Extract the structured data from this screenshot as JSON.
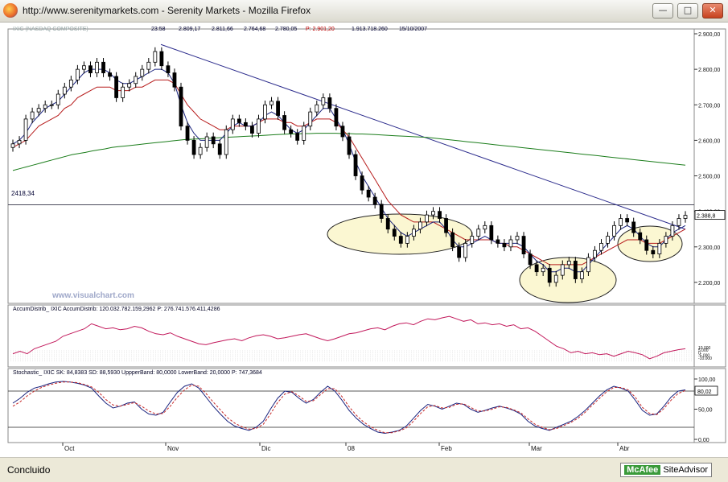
{
  "window": {
    "title": "http://www.serenitymarkets.com - Serenity Markets - Mozilla Firefox"
  },
  "status": {
    "text": "Concluido",
    "mcafee_brand": "McAfee",
    "mcafee_label": "SiteAdvisor"
  },
  "colors": {
    "price_axis_bg": "#ffffff",
    "ma_short": "#1a237e",
    "ma_mid": "#b71c1c",
    "ma_long": "#1b7d1b",
    "trendline": "#2b2b8c",
    "ellipse_fill": "#fbf7d2",
    "accum": "#c2185b",
    "stoch_k": "#1a237e",
    "stoch_d": "#c62828"
  },
  "chart_data": {
    "type": "candlestick",
    "header": {
      "time": "23:58",
      "open": "2.809,17",
      "high": "2.811,66",
      "low": "2.764,68",
      "close": "2.780,05",
      "p": "P: 2.901,20",
      "volume": "1.913.718.260",
      "date": "15/10/2007"
    },
    "watermark": "www.visualchart.com",
    "reference_line": {
      "value": 2418.34,
      "label": "2418,34"
    },
    "last_price_label": "2.388,8",
    "y_axis": {
      "min": 2150,
      "max": 2900,
      "ticks": [
        "2.900,00",
        "2.800,00",
        "2.700,00",
        "2.600,00",
        "2.500,00",
        "2.400,00",
        "2.300,00",
        "2.200,00"
      ]
    },
    "x_axis_labels": [
      "Oct",
      "Nov",
      "Dic",
      "08",
      "Feb",
      "Mar",
      "Abr"
    ],
    "closes": [
      2590,
      2600,
      2660,
      2680,
      2690,
      2700,
      2700,
      2730,
      2750,
      2770,
      2800,
      2810,
      2790,
      2820,
      2790,
      2780,
      2720,
      2750,
      2760,
      2780,
      2800,
      2820,
      2850,
      2810,
      2790,
      2750,
      2640,
      2600,
      2560,
      2580,
      2610,
      2590,
      2560,
      2630,
      2660,
      2650,
      2640,
      2620,
      2660,
      2700,
      2710,
      2670,
      2630,
      2620,
      2600,
      2640,
      2680,
      2700,
      2720,
      2690,
      2640,
      2610,
      2560,
      2500,
      2460,
      2440,
      2420,
      2380,
      2350,
      2330,
      2310,
      2330,
      2350,
      2370,
      2390,
      2400,
      2380,
      2340,
      2300,
      2270,
      2310,
      2330,
      2350,
      2360,
      2320,
      2310,
      2300,
      2320,
      2330,
      2280,
      2250,
      2230,
      2240,
      2200,
      2220,
      2250,
      2260,
      2210,
      2230,
      2270,
      2290,
      2310,
      2330,
      2360,
      2380,
      2370,
      2340,
      2320,
      2290,
      2280,
      2310,
      2330,
      2360,
      2380,
      2388.8
    ],
    "ma_short": [
      2590,
      2600,
      2620,
      2650,
      2670,
      2690,
      2700,
      2710,
      2730,
      2750,
      2770,
      2790,
      2800,
      2800,
      2800,
      2790,
      2770,
      2760,
      2760,
      2770,
      2780,
      2790,
      2800,
      2800,
      2790,
      2760,
      2700,
      2650,
      2620,
      2600,
      2600,
      2600,
      2600,
      2620,
      2640,
      2650,
      2640,
      2640,
      2650,
      2670,
      2680,
      2670,
      2650,
      2630,
      2620,
      2630,
      2650,
      2670,
      2690,
      2690,
      2660,
      2630,
      2590,
      2540,
      2500,
      2470,
      2440,
      2410,
      2380,
      2360,
      2340,
      2330,
      2340,
      2350,
      2360,
      2370,
      2370,
      2350,
      2320,
      2300,
      2300,
      2310,
      2320,
      2330,
      2320,
      2310,
      2310,
      2310,
      2310,
      2300,
      2280,
      2260,
      2250,
      2230,
      2230,
      2240,
      2240,
      2230,
      2230,
      2250,
      2270,
      2290,
      2310,
      2330,
      2350,
      2360,
      2350,
      2330,
      2310,
      2300,
      2300,
      2320,
      2340,
      2350,
      2360
    ],
    "ma_mid": [
      2580,
      2590,
      2600,
      2620,
      2640,
      2650,
      2660,
      2670,
      2690,
      2700,
      2720,
      2730,
      2740,
      2750,
      2750,
      2750,
      2740,
      2740,
      2740,
      2750,
      2750,
      2760,
      2770,
      2770,
      2770,
      2760,
      2730,
      2700,
      2680,
      2660,
      2650,
      2640,
      2630,
      2630,
      2640,
      2640,
      2640,
      2640,
      2650,
      2660,
      2660,
      2660,
      2650,
      2650,
      2640,
      2640,
      2650,
      2660,
      2660,
      2660,
      2650,
      2630,
      2610,
      2580,
      2550,
      2520,
      2490,
      2460,
      2430,
      2410,
      2390,
      2380,
      2370,
      2370,
      2370,
      2370,
      2360,
      2350,
      2340,
      2330,
      2320,
      2320,
      2320,
      2320,
      2320,
      2310,
      2310,
      2300,
      2300,
      2290,
      2280,
      2270,
      2260,
      2250,
      2250,
      2250,
      2250,
      2250,
      2250,
      2260,
      2270,
      2280,
      2290,
      2300,
      2310,
      2320,
      2320,
      2320,
      2310,
      2310,
      2310,
      2320,
      2330,
      2340,
      2350
    ],
    "ma_long": [
      2515,
      2520,
      2525,
      2530,
      2535,
      2540,
      2545,
      2550,
      2555,
      2560,
      2563,
      2566,
      2570,
      2573,
      2576,
      2580,
      2582,
      2584,
      2586,
      2588,
      2590,
      2592,
      2594,
      2596,
      2598,
      2600,
      2602,
      2603,
      2604,
      2605,
      2606,
      2607,
      2608,
      2609,
      2610,
      2611,
      2612,
      2613,
      2614,
      2615,
      2616,
      2617,
      2618,
      2618,
      2619,
      2619,
      2620,
      2620,
      2620,
      2620,
      2619,
      2619,
      2618,
      2618,
      2617,
      2616,
      2615,
      2614,
      2613,
      2612,
      2611,
      2610,
      2609,
      2608,
      2606,
      2604,
      2602,
      2600,
      2598,
      2596,
      2594,
      2592,
      2590,
      2588,
      2586,
      2584,
      2582,
      2580,
      2578,
      2576,
      2574,
      2572,
      2570,
      2568,
      2566,
      2564,
      2562,
      2560,
      2558,
      2556,
      2554,
      2552,
      2550,
      2548,
      2546,
      2544,
      2542,
      2540,
      2538,
      2536,
      2534,
      2532,
      2530
    ],
    "accum_distrib": {
      "label": "AccumDistrib_ IXIC AccumDistrib: 120.032.782.159,2962 P: 276.741.576.411,4286",
      "values": [
        0.2,
        0.25,
        0.2,
        0.3,
        0.35,
        0.4,
        0.45,
        0.55,
        0.6,
        0.65,
        0.7,
        0.8,
        0.75,
        0.7,
        0.72,
        0.68,
        0.7,
        0.75,
        0.72,
        0.65,
        0.6,
        0.58,
        0.62,
        0.55,
        0.5,
        0.45,
        0.4,
        0.38,
        0.42,
        0.45,
        0.48,
        0.5,
        0.46,
        0.52,
        0.56,
        0.58,
        0.55,
        0.5,
        0.52,
        0.55,
        0.58,
        0.6,
        0.55,
        0.5,
        0.46,
        0.5,
        0.55,
        0.6,
        0.62,
        0.66,
        0.7,
        0.72,
        0.68,
        0.75,
        0.8,
        0.82,
        0.78,
        0.85,
        0.9,
        0.88,
        0.92,
        0.95,
        0.9,
        0.85,
        0.88,
        0.8,
        0.82,
        0.78,
        0.8,
        0.75,
        0.78,
        0.7,
        0.72,
        0.65,
        0.55,
        0.45,
        0.35,
        0.3,
        0.22,
        0.25,
        0.2,
        0.22,
        0.18,
        0.2,
        0.15,
        0.2,
        0.25,
        0.22,
        0.18,
        0.1,
        0.15,
        0.22,
        0.25,
        0.28,
        0.3
      ],
      "ticks": [
        "10.000",
        "5.000",
        "0",
        "-5.000",
        "-10.000"
      ]
    },
    "stochastic": {
      "label": "Stochastic_ IXIC SK: 84,8383 SD: 88,5930 UppperBand: 80,0000 LowerBand: 20,0000 P: 747,3684",
      "upper_band": 80,
      "lower_band": 20,
      "last_label": "80,02",
      "ticks": [
        "100,00",
        "50,00",
        "0,00"
      ],
      "k": [
        60,
        68,
        78,
        85,
        88,
        92,
        95,
        96,
        95,
        93,
        90,
        85,
        72,
        60,
        52,
        55,
        60,
        62,
        50,
        42,
        40,
        45,
        62,
        78,
        88,
        92,
        85,
        70,
        55,
        42,
        30,
        22,
        18,
        15,
        20,
        30,
        50,
        68,
        80,
        78,
        68,
        60,
        66,
        78,
        88,
        80,
        65,
        48,
        35,
        25,
        18,
        12,
        10,
        12,
        15,
        22,
        35,
        48,
        58,
        55,
        50,
        55,
        60,
        58,
        50,
        45,
        48,
        52,
        55,
        52,
        48,
        42,
        30,
        22,
        18,
        15,
        20,
        25,
        30,
        38,
        48,
        60,
        72,
        82,
        88,
        85,
        80,
        65,
        48,
        40,
        42,
        55,
        70,
        80,
        82
      ],
      "d": [
        55,
        62,
        72,
        80,
        86,
        90,
        93,
        95,
        95,
        94,
        91,
        87,
        78,
        66,
        57,
        55,
        58,
        61,
        55,
        47,
        42,
        43,
        55,
        70,
        82,
        90,
        88,
        76,
        62,
        49,
        36,
        27,
        21,
        17,
        18,
        25,
        42,
        61,
        75,
        79,
        72,
        63,
        64,
        74,
        84,
        84,
        71,
        54,
        40,
        29,
        21,
        15,
        11,
        11,
        14,
        19,
        30,
        43,
        54,
        56,
        52,
        53,
        58,
        59,
        53,
        47,
        47,
        50,
        54,
        53,
        49,
        44,
        34,
        25,
        20,
        16,
        18,
        23,
        28,
        35,
        45,
        57,
        68,
        79,
        86,
        86,
        82,
        70,
        53,
        43,
        41,
        51,
        65,
        76,
        81
      ]
    }
  }
}
